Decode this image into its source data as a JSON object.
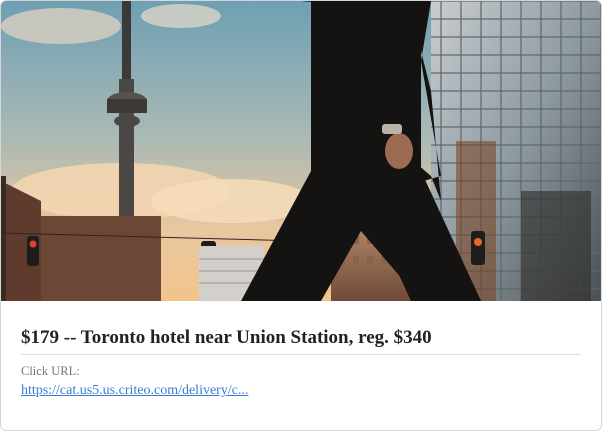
{
  "ad": {
    "title": "$179 -- Toronto hotel near Union Station, reg. $340",
    "click_label": "Click URL:",
    "click_url": "https://cat.us5.us.criteo.com/delivery/c..."
  },
  "image": {
    "subject": "Toronto skyline with CN Tower and a walking businessman at sunset"
  },
  "colors": {
    "title": "#222222",
    "link": "#3a7bd5",
    "label": "#777777",
    "border": "#d6d6d6"
  }
}
